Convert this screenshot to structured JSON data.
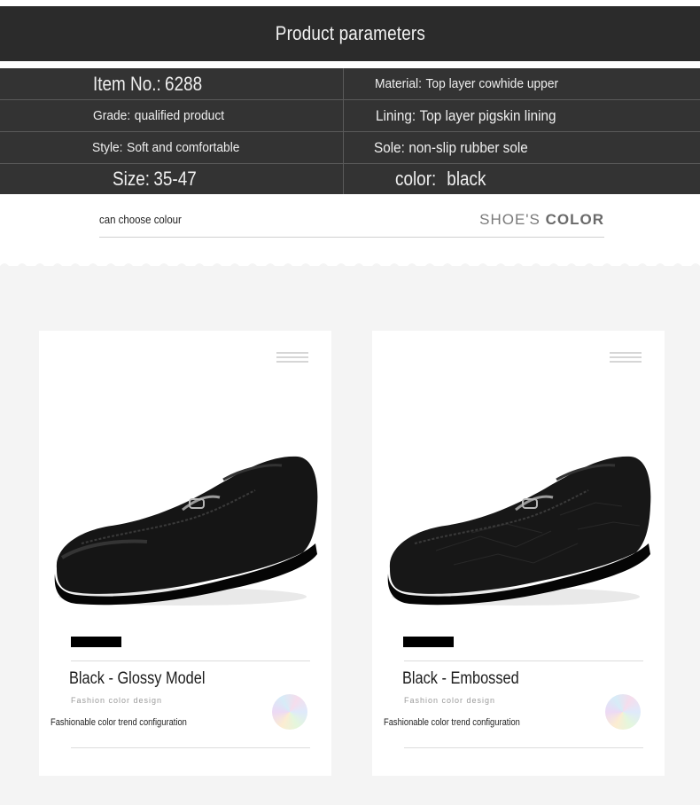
{
  "banner": {
    "title": "Product parameters"
  },
  "parameters": {
    "item_no": {
      "label": "Item No.:",
      "value": "6288"
    },
    "material": {
      "label": "Material:",
      "value": "Top layer cowhide upper"
    },
    "grade": {
      "label": "Grade:",
      "value": "qualified product"
    },
    "lining": {
      "label": "Lining:",
      "value": "Top layer pigskin lining"
    },
    "style": {
      "label": "Style:",
      "value": "Soft and comfortable"
    },
    "sole": {
      "label": "Sole:",
      "value": "non-slip rubber sole"
    },
    "size": {
      "label": "Size:",
      "value": "35-47"
    },
    "color": {
      "label": "color:",
      "value": "black"
    }
  },
  "color_section": {
    "subtitle": "can choose colour",
    "heading_light": "SHOE'S",
    "heading_bold": "COLOR"
  },
  "cards": [
    {
      "model": "Black - Glossy Model",
      "tagline": "Fashion color design",
      "trend": "Fashionable color trend configuration"
    },
    {
      "model": "Black - Embossed",
      "tagline": "Fashion color design",
      "trend": "Fashionable color trend configuration"
    }
  ],
  "colors": {
    "dark_band": "#2b2b2b",
    "param_bg": "#333333",
    "page_gray": "#f4f4f4",
    "card_bg": "#ffffff"
  }
}
